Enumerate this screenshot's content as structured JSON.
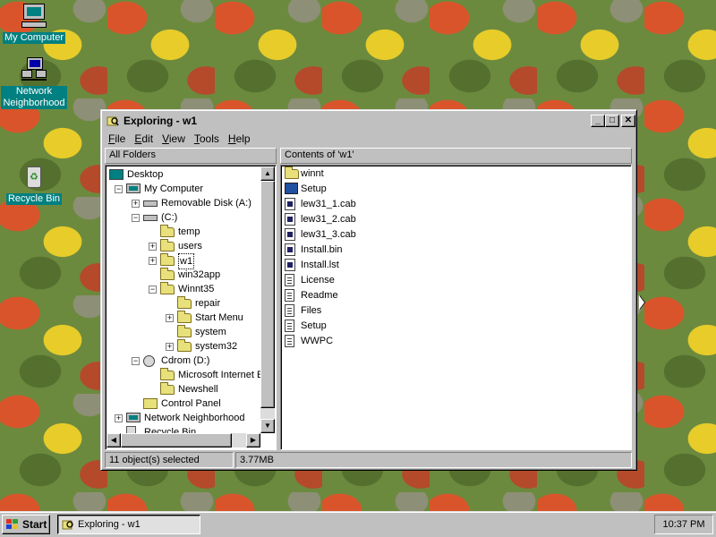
{
  "desktop": {
    "icons": [
      {
        "label": "My Computer",
        "icon": "my-computer-icon"
      },
      {
        "label": "Network Neighborhood",
        "icon": "network-neighborhood-icon"
      },
      {
        "label": "Recycle Bin",
        "icon": "recycle-bin-icon"
      }
    ]
  },
  "window": {
    "title": "Exploring - w1",
    "buttons": {
      "minimize": "_",
      "maximize": "□",
      "close": "✕"
    },
    "menu": [
      "File",
      "Edit",
      "View",
      "Tools",
      "Help"
    ],
    "left_header": "All Folders",
    "right_header": "Contents of 'w1'",
    "tree": [
      {
        "label": "Desktop",
        "icon": "desktop-icon",
        "expander": ""
      },
      {
        "label": "My Computer",
        "icon": "computer-icon",
        "expander": "−"
      },
      {
        "label": "Removable Disk (A:)",
        "icon": "drive-icon",
        "expander": "+"
      },
      {
        "label": "(C:)",
        "icon": "drive-icon",
        "expander": "−"
      },
      {
        "label": "temp",
        "icon": "folder-icon",
        "expander": ""
      },
      {
        "label": "users",
        "icon": "folder-icon",
        "expander": "+"
      },
      {
        "label": "w1",
        "icon": "open-folder-icon",
        "expander": "+"
      },
      {
        "label": "win32app",
        "icon": "folder-icon",
        "expander": ""
      },
      {
        "label": "Winnt35",
        "icon": "folder-icon",
        "expander": "−"
      },
      {
        "label": "repair",
        "icon": "folder-icon",
        "expander": ""
      },
      {
        "label": "Start Menu",
        "icon": "folder-icon",
        "expander": "+"
      },
      {
        "label": "system",
        "icon": "folder-icon",
        "expander": ""
      },
      {
        "label": "system32",
        "icon": "folder-icon",
        "expander": "+"
      },
      {
        "label": "Cdrom (D:)",
        "icon": "cdrom-icon",
        "expander": "−"
      },
      {
        "label": "Microsoft Internet E:",
        "icon": "folder-icon",
        "expander": ""
      },
      {
        "label": "Newshell",
        "icon": "folder-icon",
        "expander": ""
      },
      {
        "label": "Control Panel",
        "icon": "control-panel-icon",
        "expander": ""
      },
      {
        "label": "Network Neighborhood",
        "icon": "network-icon",
        "expander": "+"
      },
      {
        "label": "Recycle Bin",
        "icon": "recycle-bin-icon",
        "expander": ""
      }
    ],
    "contents": [
      {
        "label": "winnt",
        "icon": "folder-icon"
      },
      {
        "label": "Setup",
        "icon": "setup-icon"
      },
      {
        "label": "lew31_1.cab",
        "icon": "cab-file-icon"
      },
      {
        "label": "lew31_2.cab",
        "icon": "cab-file-icon"
      },
      {
        "label": "lew31_3.cab",
        "icon": "cab-file-icon"
      },
      {
        "label": "Install.bin",
        "icon": "cab-file-icon"
      },
      {
        "label": "Install.lst",
        "icon": "cab-file-icon"
      },
      {
        "label": "License",
        "icon": "text-file-icon"
      },
      {
        "label": "Readme",
        "icon": "text-file-icon"
      },
      {
        "label": "Files",
        "icon": "text-file-icon"
      },
      {
        "label": "Setup",
        "icon": "text-file-icon"
      },
      {
        "label": "WWPC",
        "icon": "text-file-icon"
      }
    ],
    "status": {
      "selected": "11 object(s) selected",
      "size": "3.77MB"
    }
  },
  "taskbar": {
    "start_label": "Start",
    "task_label": "Exploring - w1",
    "clock": "10:37 PM"
  }
}
